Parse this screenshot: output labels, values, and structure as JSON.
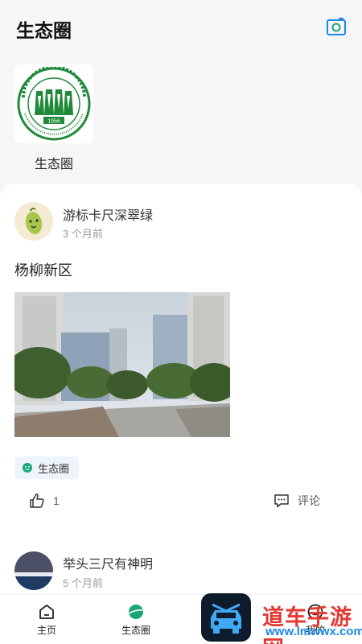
{
  "header": {
    "title": "生态圈",
    "camera_icon": "camera-icon"
  },
  "community": {
    "name": "生态圈",
    "logo_icon": "school-seal-logo",
    "logo_year": "1956",
    "colors": {
      "seal_green": "#1f8a3a"
    }
  },
  "posts": [
    {
      "username": "游标卡尺深翠绿",
      "time": "3 个月前",
      "text": "杨柳新区",
      "tag": "生态圈",
      "like_count": "1",
      "comment_label": "评论"
    },
    {
      "username": "举头三尺有神明",
      "time": "5 个月前"
    }
  ],
  "tabbar": {
    "items": [
      {
        "label": "主页",
        "icon": "home-icon",
        "active": false
      },
      {
        "label": "生态圈",
        "icon": "planet-icon",
        "active": true
      },
      {
        "label": "我的",
        "icon": "profile-icon",
        "active": false
      }
    ]
  },
  "watermark": {
    "text": "道车手游网",
    "url": "www.lmwwx.com"
  },
  "colors": {
    "accent": "#1aa67a",
    "brand_blue": "#1e88e5",
    "tag_bg": "#eef4fb"
  }
}
